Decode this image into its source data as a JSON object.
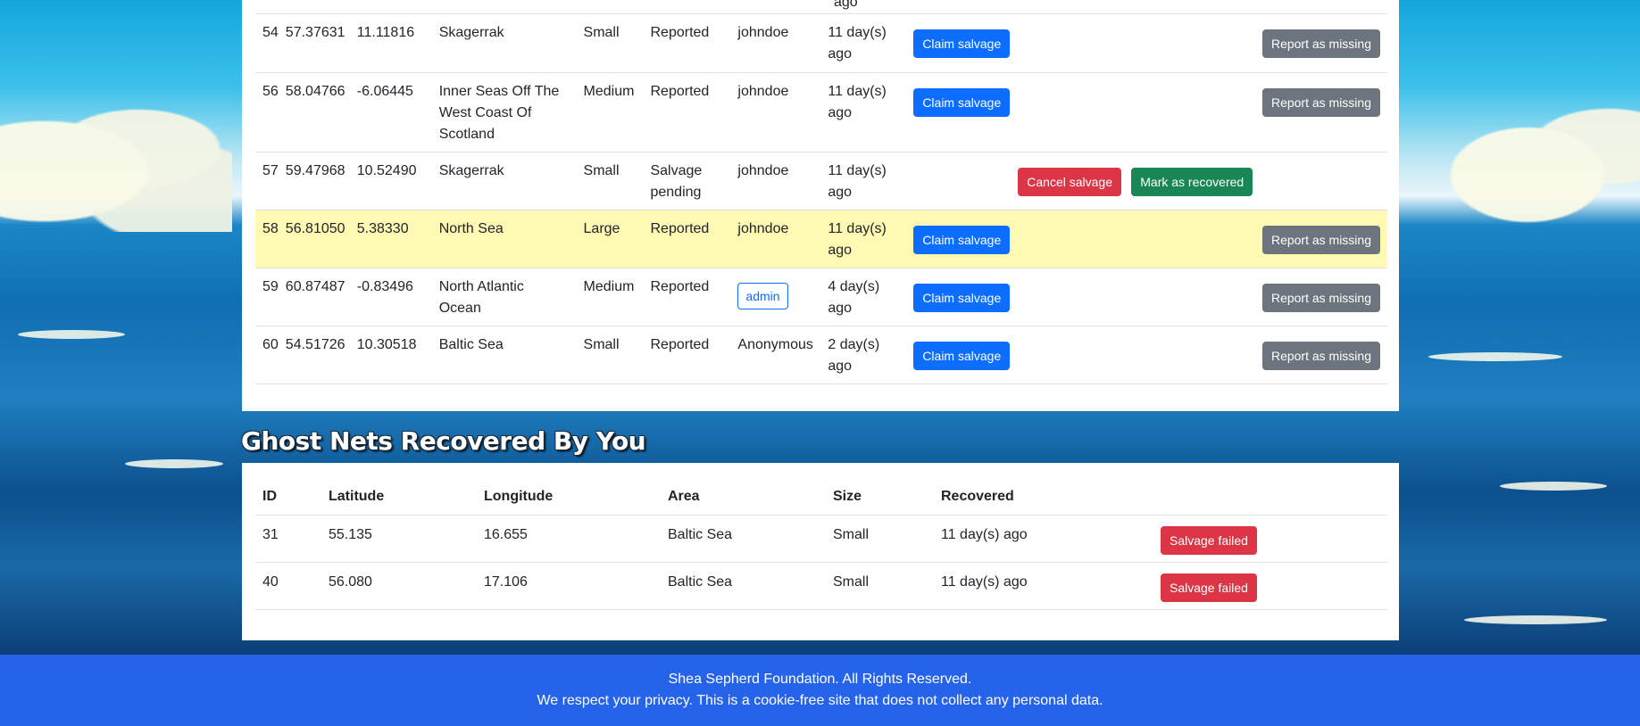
{
  "reports": {
    "top_stub_text": "ago",
    "rows": [
      {
        "id": "54",
        "lat": "57.37631",
        "lon": "11.11816",
        "area": "Skagerrak",
        "size": "Small",
        "status": "Reported",
        "user": "johndoe",
        "when": "11 day(s) ago",
        "claim": "Claim salvage",
        "missing": "Report as missing"
      },
      {
        "id": "56",
        "lat": "58.04766",
        "lon": "-6.06445",
        "area": "Inner Seas Off The West Coast Of Scotland",
        "size": "Medium",
        "status": "Reported",
        "user": "johndoe",
        "when": "11 day(s) ago",
        "claim": "Claim salvage",
        "missing": "Report as missing"
      },
      {
        "id": "57",
        "lat": "59.47968",
        "lon": "10.52490",
        "area": "Skagerrak",
        "size": "Small",
        "status": "Salvage pending",
        "user": "johndoe",
        "when": "11 day(s) ago",
        "cancel": "Cancel salvage",
        "recovered": "Mark as recovered"
      },
      {
        "id": "58",
        "lat": "56.81050",
        "lon": "5.38330",
        "area": "North Sea",
        "size": "Large",
        "status": "Reported",
        "user": "johndoe",
        "when": "11 day(s) ago",
        "claim": "Claim salvage",
        "missing": "Report as missing"
      },
      {
        "id": "59",
        "lat": "60.87487",
        "lon": "-0.83496",
        "area": "North Atlantic Ocean",
        "size": "Medium",
        "status": "Reported",
        "user": "admin",
        "when": "4 day(s) ago",
        "claim": "Claim salvage",
        "missing": "Report as missing"
      },
      {
        "id": "60",
        "lat": "54.51726",
        "lon": "10.30518",
        "area": "Baltic Sea",
        "size": "Small",
        "status": "Reported",
        "user": "Anonymous",
        "when": "2 day(s) ago",
        "claim": "Claim salvage",
        "missing": "Report as missing"
      }
    ]
  },
  "recovered": {
    "title": "Ghost Nets Recovered By You",
    "headers": {
      "id": "ID",
      "lat": "Latitude",
      "lon": "Longitude",
      "area": "Area",
      "size": "Size",
      "recovered": "Recovered"
    },
    "rows": [
      {
        "id": "31",
        "lat": "55.135",
        "lon": "16.655",
        "area": "Baltic Sea",
        "size": "Small",
        "when": "11 day(s) ago",
        "action": "Salvage failed"
      },
      {
        "id": "40",
        "lat": "56.080",
        "lon": "17.106",
        "area": "Baltic Sea",
        "size": "Small",
        "when": "11 day(s) ago",
        "action": "Salvage failed"
      }
    ]
  },
  "footer": {
    "line1": "Shea Sepherd Foundation. All Rights Reserved.",
    "line2": "We respect your privacy. This is a cookie-free site that does not collect any personal data."
  },
  "colors": {
    "primary": "#0d6efd",
    "secondary": "#6c757d",
    "danger": "#dc3545",
    "success": "#198754",
    "highlight_row": "#fff9b4",
    "footer_bg": "#2563eb"
  }
}
